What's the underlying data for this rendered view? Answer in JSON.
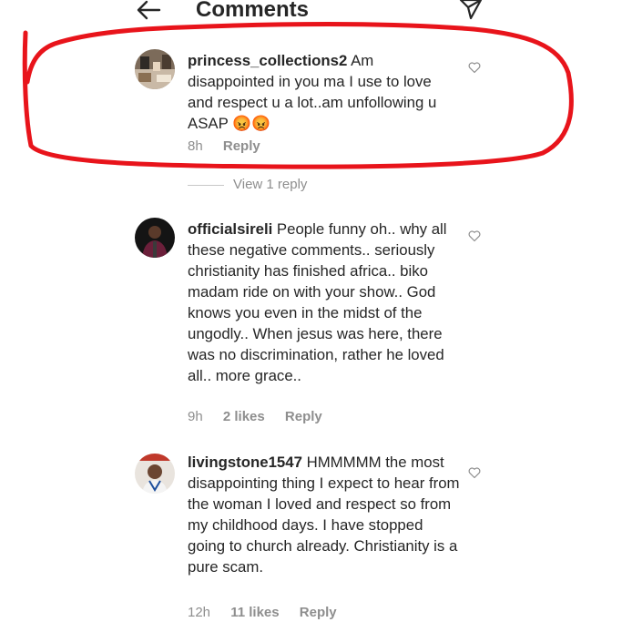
{
  "header": {
    "title": "Comments",
    "back_icon": "arrow-left-icon",
    "send_icon": "paper-plane-icon"
  },
  "comments": [
    {
      "username": "princess_collections2",
      "text": " Am disappointed in you ma I use to love and respect u a lot..am unfollowing u ASAP 😡😡",
      "time": "8h",
      "likes": "",
      "reply_label": "Reply",
      "view_replies": "View 1 reply"
    },
    {
      "username": "officialsireli",
      "text": " People funny oh.. why all these negative comments.. seriously christianity has finished africa.. biko madam ride on with your show.. God knows you even in the midst of the ungodly.. When jesus was here, there was no discrimination, rather he loved all.. more grace..",
      "time": "9h",
      "likes": "2 likes",
      "reply_label": "Reply"
    },
    {
      "username": "livingstone1547",
      "text": " HMMMMM the most disappointing thing I expect to hear from the woman I loved and respect so from my childhood days. I have stopped going to church already. Christianity is a pure scam.",
      "time": "12h",
      "likes": "11 likes",
      "reply_label": "Reply"
    }
  ],
  "colors": {
    "text": "#262626",
    "secondary": "#8e8e8e",
    "annotation": "#e8141b"
  }
}
